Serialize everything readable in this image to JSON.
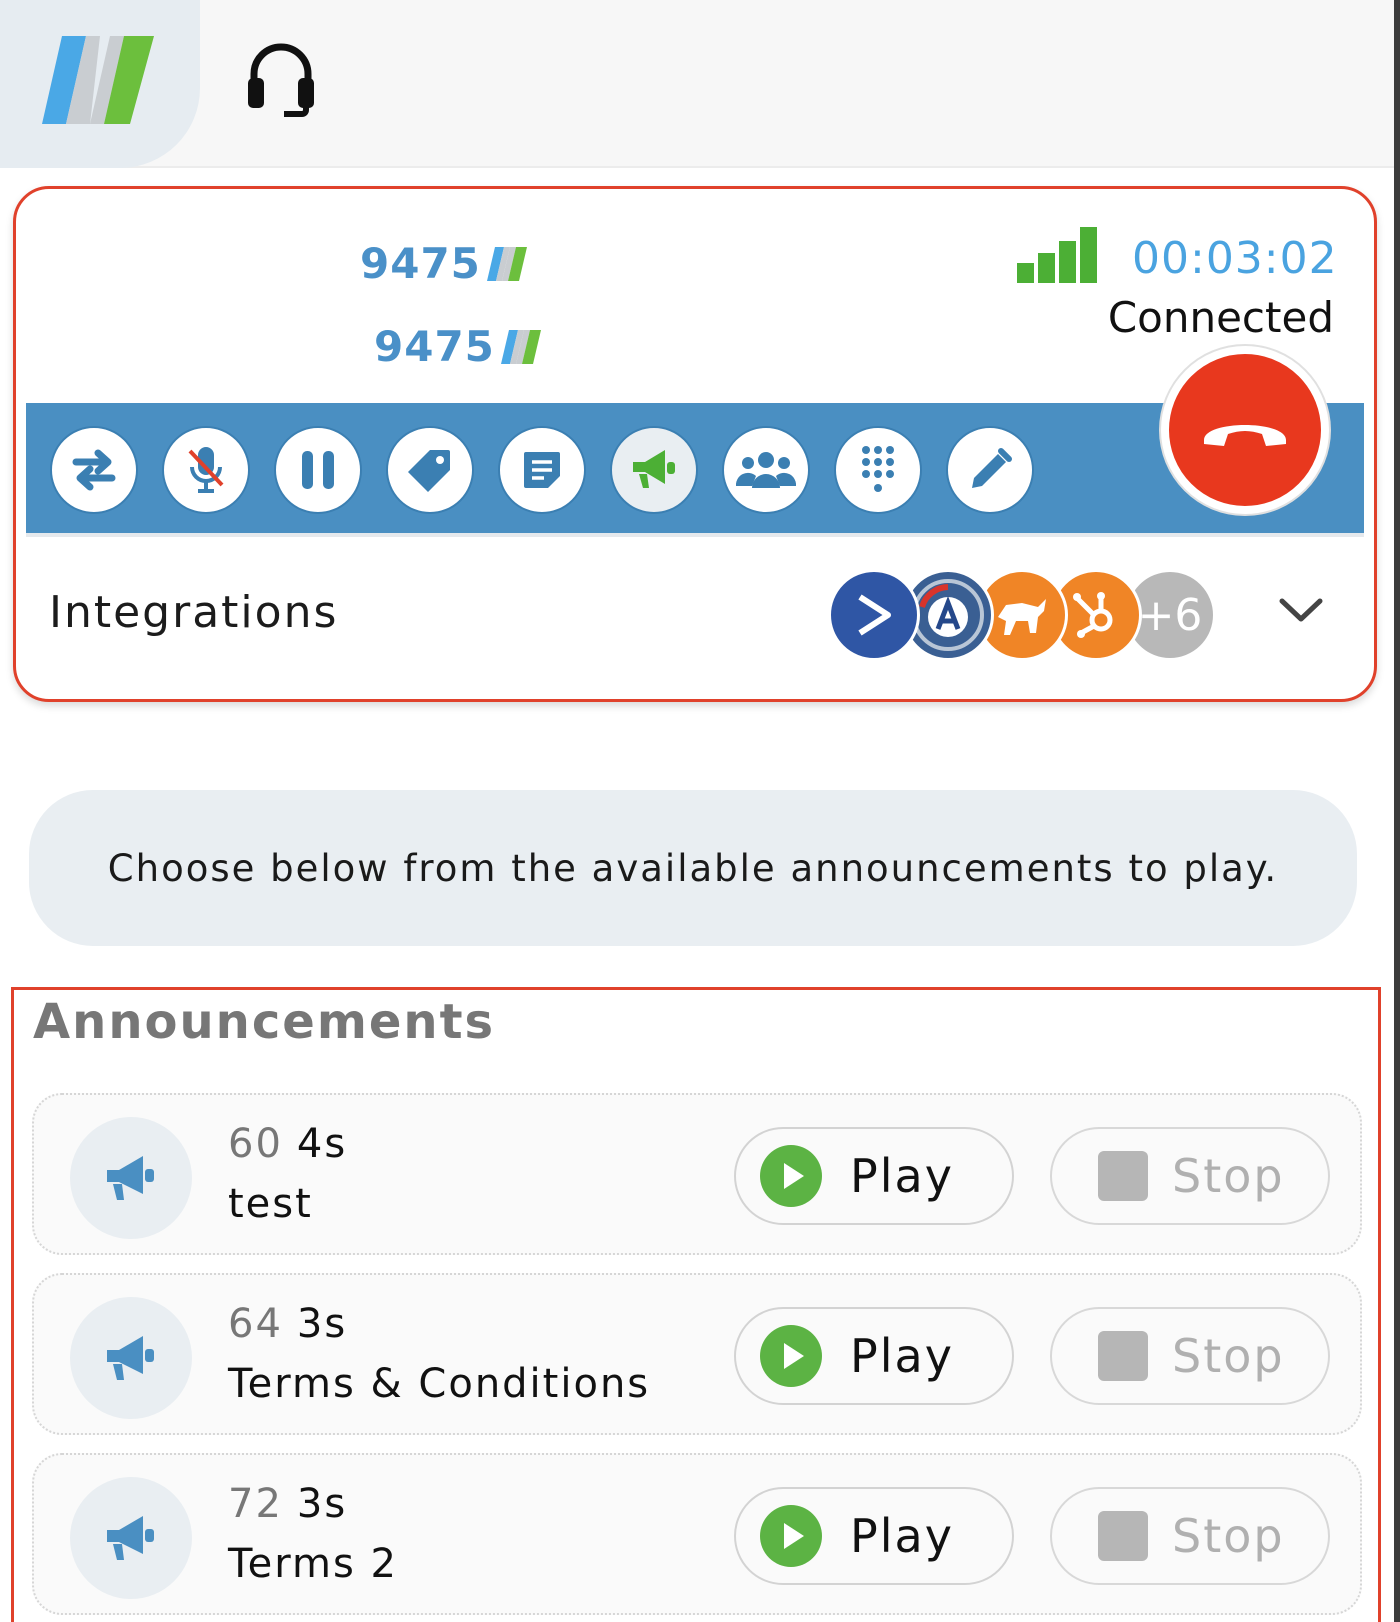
{
  "header": {
    "logo": "brand-logo",
    "headset_icon": "headset-icon"
  },
  "call": {
    "caller_primary": "9475",
    "caller_secondary": "9475",
    "timer": "00:03:02",
    "status": "Connected",
    "signal_bars": 4,
    "colors": {
      "timer": "#4aa3e0",
      "signal": "#4caf35",
      "hangup": "#e8381e",
      "toolbar": "#4a8fc2",
      "accent_border": "#e0412b"
    }
  },
  "toolbar": {
    "buttons": [
      {
        "icon": "transfer-icon"
      },
      {
        "icon": "mute-mic-icon"
      },
      {
        "icon": "pause-icon"
      },
      {
        "icon": "tag-icon"
      },
      {
        "icon": "notes-icon"
      },
      {
        "icon": "announcement-icon",
        "active": true
      },
      {
        "icon": "conference-icon"
      },
      {
        "icon": "dialpad-icon"
      },
      {
        "icon": "edit-icon"
      }
    ],
    "hangup_icon": "hangup-icon"
  },
  "integrations": {
    "label": "Integrations",
    "icons": [
      "activecampaign-icon",
      "autotask-icon",
      "pipedrive-icon",
      "hubspot-icon"
    ],
    "more_count": "+6"
  },
  "info": {
    "text": "Choose below from the available announcements to play."
  },
  "announcements": {
    "title": "Announcements",
    "play_label": "Play",
    "stop_label": "Stop",
    "items": [
      {
        "id": "60",
        "duration": "4s",
        "name": "test"
      },
      {
        "id": "64",
        "duration": "3s",
        "name": "Terms & Conditions"
      },
      {
        "id": "72",
        "duration": "3s",
        "name": "Terms 2"
      }
    ]
  }
}
